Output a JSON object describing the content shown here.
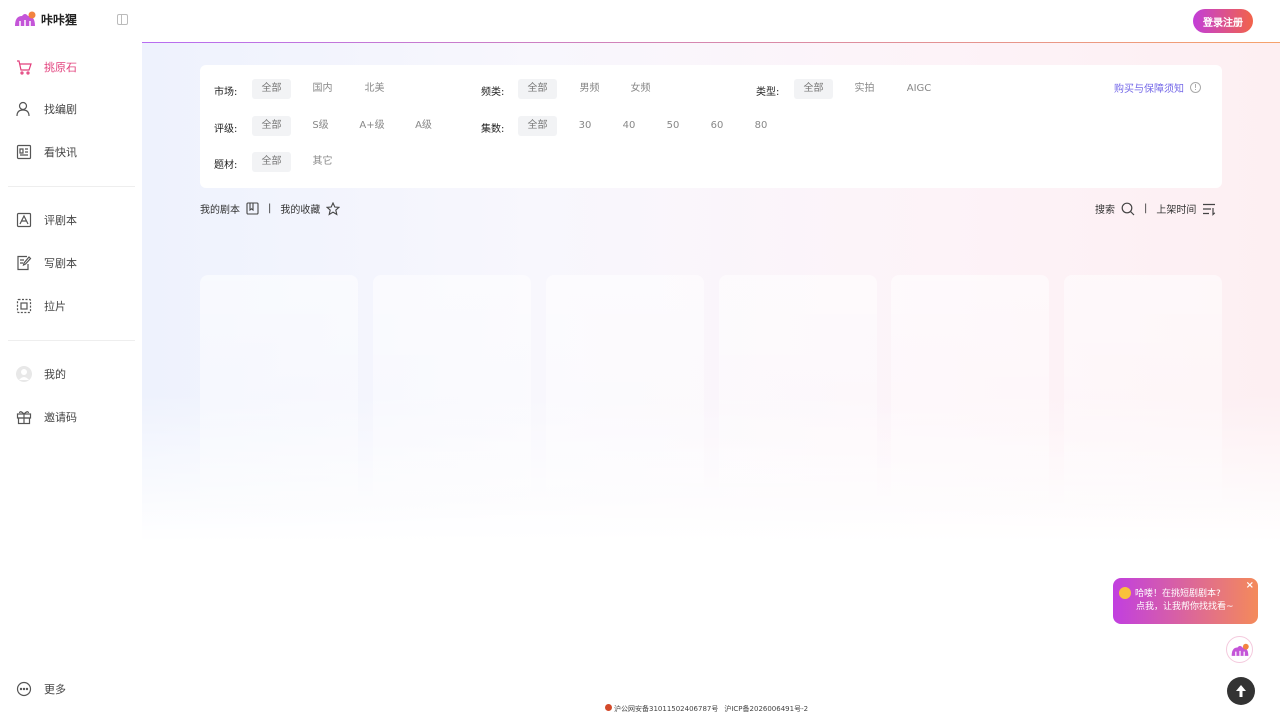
{
  "app": {
    "name": "咔咔猩"
  },
  "sidebar": {
    "items": [
      {
        "label": "挑原石",
        "icon": "cart-icon"
      },
      {
        "label": "找编剧",
        "icon": "person-icon"
      },
      {
        "label": "看快讯",
        "icon": "news-icon"
      },
      {
        "label": "评剧本",
        "icon": "review-icon"
      },
      {
        "label": "写剧本",
        "icon": "write-icon"
      },
      {
        "label": "拉片",
        "icon": "frame-icon"
      },
      {
        "label": "我的",
        "icon": "avatar"
      },
      {
        "label": "邀请码",
        "icon": "gift-icon"
      }
    ],
    "more_label": "更多"
  },
  "header": {
    "login_label": "登录注册"
  },
  "filters": {
    "market": {
      "label": "市场:",
      "options": [
        "全部",
        "国内",
        "北美"
      ]
    },
    "channel": {
      "label": "频类:",
      "options": [
        "全部",
        "男频",
        "女频"
      ]
    },
    "type": {
      "label": "类型:",
      "options": [
        "全部",
        "实拍",
        "AIGC"
      ]
    },
    "grade": {
      "label": "评级:",
      "options": [
        "全部",
        "S级",
        "A+级",
        "A级"
      ]
    },
    "episodes": {
      "label": "集数:",
      "options": [
        "全部",
        "30",
        "40",
        "50",
        "60",
        "80"
      ]
    },
    "theme": {
      "label": "题材:",
      "options": [
        "全部",
        "其它"
      ]
    },
    "notice": "购买与保障须知"
  },
  "toolbar": {
    "my_scripts": "我的剧本",
    "separator": "|",
    "my_favorites": "我的收藏",
    "search": "搜索",
    "sort": "上架时间"
  },
  "chat_bubble": {
    "line1": "哈喽！在挑短剧剧本?",
    "line2": "点我，让我帮你找找看~",
    "close": "×"
  },
  "footer": {
    "police": "沪公网安备31011502406787号",
    "icp": "沪ICP备2026006491号-2"
  },
  "colors": {
    "accent": "#e2407c",
    "link": "#7468e8"
  }
}
